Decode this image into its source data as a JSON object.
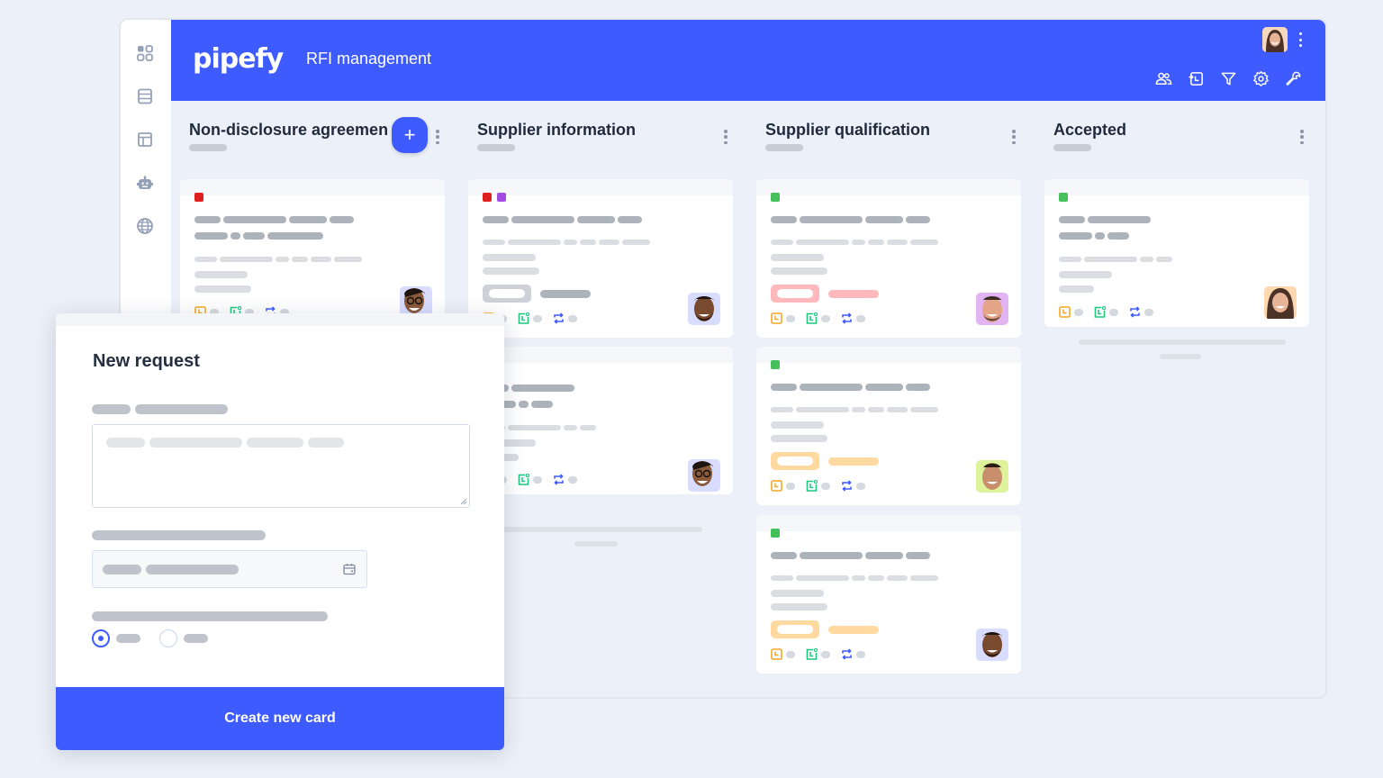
{
  "header": {
    "logo": "pipefy",
    "pipe_title": "RFI management",
    "tools": [
      "members-icon",
      "import-icon",
      "filter-icon",
      "settings-icon",
      "wrench-icon"
    ]
  },
  "sidebar": {
    "items": [
      {
        "icon": "apps-grid-icon"
      },
      {
        "icon": "database-icon"
      },
      {
        "icon": "layout-icon"
      },
      {
        "icon": "bot-icon"
      },
      {
        "icon": "globe-icon"
      }
    ]
  },
  "columns": [
    {
      "title": "Non-disclosure agreement",
      "add_label": "+"
    },
    {
      "title": "Supplier information"
    },
    {
      "title": "Supplier qualification"
    },
    {
      "title": "Accepted"
    }
  ],
  "colors": {
    "brand": "#3E5BFF",
    "tag_red": "#E02020",
    "tag_purple": "#A24BE0",
    "tag_green": "#45C05A",
    "badge_red": "#FFB8BC",
    "badge_orange": "#FFD9A0",
    "badge_gray": "#CED2D8",
    "icon_orange": "#F5A623",
    "icon_green": "#1FC77E",
    "icon_blue": "#3E5BFF"
  },
  "modal": {
    "title": "New request",
    "submit_label": "Create new card",
    "radio_selected_index": 0
  }
}
